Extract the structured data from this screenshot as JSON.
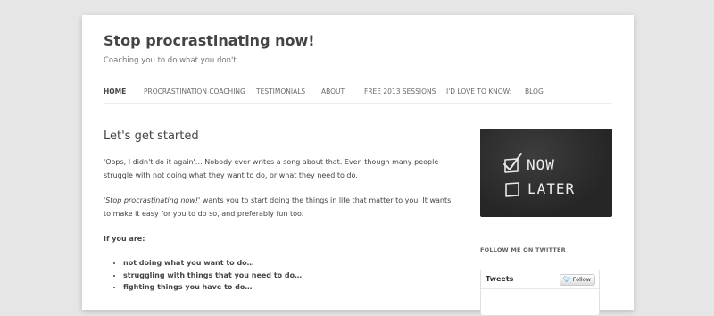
{
  "site": {
    "title": "Stop procrastinating now!",
    "description": "Coaching you to do what you don't"
  },
  "nav": {
    "items": [
      {
        "label": "HOME"
      },
      {
        "label": "PROCRASTINATION COACHING"
      },
      {
        "label": "TESTIMONIALS"
      },
      {
        "label": "ABOUT"
      },
      {
        "label": "FREE 2013 SESSIONS"
      },
      {
        "label": "I'D LOVE TO KNOW:"
      },
      {
        "label": "BLOG"
      }
    ]
  },
  "content": {
    "title": "Let's get started",
    "p1": "'Oops, I didn't do it again'… Nobody ever writes a song about that. Even though many people struggle with not doing what they want to do, or what they need to do.",
    "p2_em": "'Stop procrastinating now!'",
    "p2_rest": " wants you to start doing the things in life that matter to you. It wants to make it easy for you to do so, and preferably fun too.",
    "if_you_are": "If you are:",
    "bullets": [
      "not doing what you want to do…",
      "struggling with things that you need to do…",
      "fighting things you have to do…"
    ]
  },
  "sidebar": {
    "image": {
      "now": "NOW",
      "later": "LATER"
    },
    "twitter_title": "FOLLOW ME ON TWITTER",
    "tweets_label": "Tweets",
    "follow_label": "Follow",
    "bird_icon": "twitter-bird-icon"
  },
  "colors": {
    "background": "#e6e6e6",
    "page": "#ffffff",
    "text": "#444444",
    "chalkboard": "#2b2b2b",
    "twitter_blue": "#2ea2dc"
  }
}
